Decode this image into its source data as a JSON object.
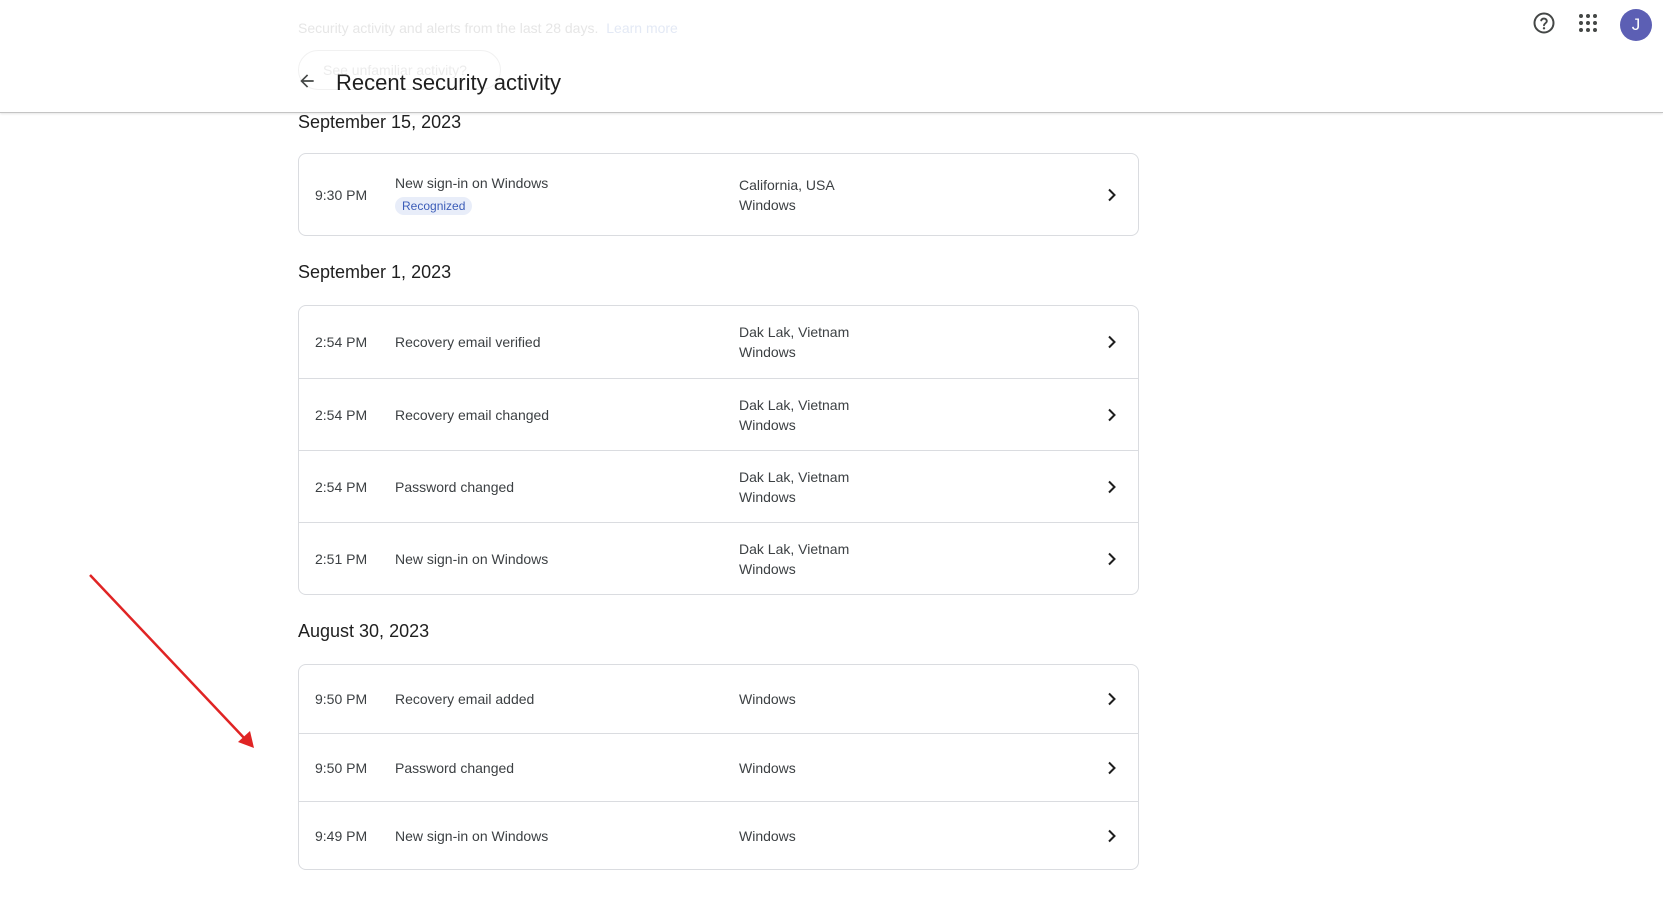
{
  "header": {
    "title": "Recent security activity",
    "back_icon": "arrow-back-icon",
    "help_icon": "help-circle-icon",
    "apps_icon": "apps-grid-icon",
    "avatar_initial": "J",
    "avatar_color": "#5c5fb4"
  },
  "scrolled_under": {
    "description": "Security activity and alerts from the last 28 days.",
    "learn_more": "Learn more",
    "review_button": "See unfamiliar activity?"
  },
  "groups": [
    {
      "date": "September 15, 2023",
      "rows": [
        {
          "time": "9:30 PM",
          "event": "New sign-in on Windows",
          "badge": "Recognized",
          "location": "California, USA",
          "device": "Windows"
        }
      ]
    },
    {
      "date": "September 1, 2023",
      "rows": [
        {
          "time": "2:54 PM",
          "event": "Recovery email verified",
          "location": "Dak Lak, Vietnam",
          "device": "Windows"
        },
        {
          "time": "2:54 PM",
          "event": "Recovery email changed",
          "location": "Dak Lak, Vietnam",
          "device": "Windows"
        },
        {
          "time": "2:54 PM",
          "event": "Password changed",
          "location": "Dak Lak, Vietnam",
          "device": "Windows"
        },
        {
          "time": "2:51 PM",
          "event": "New sign-in on Windows",
          "location": "Dak Lak, Vietnam",
          "device": "Windows"
        }
      ]
    },
    {
      "date": "August 30, 2023",
      "rows": [
        {
          "time": "9:50 PM",
          "event": "Recovery email added",
          "device": "Windows"
        },
        {
          "time": "9:50 PM",
          "event": "Password changed",
          "device": "Windows"
        },
        {
          "time": "9:49 PM",
          "event": "New sign-in on Windows",
          "device": "Windows"
        }
      ]
    }
  ],
  "colors": {
    "badge_bg": "#e8edf9",
    "badge_text": "#3b5cb8",
    "annotation_arrow": "#e02424"
  }
}
